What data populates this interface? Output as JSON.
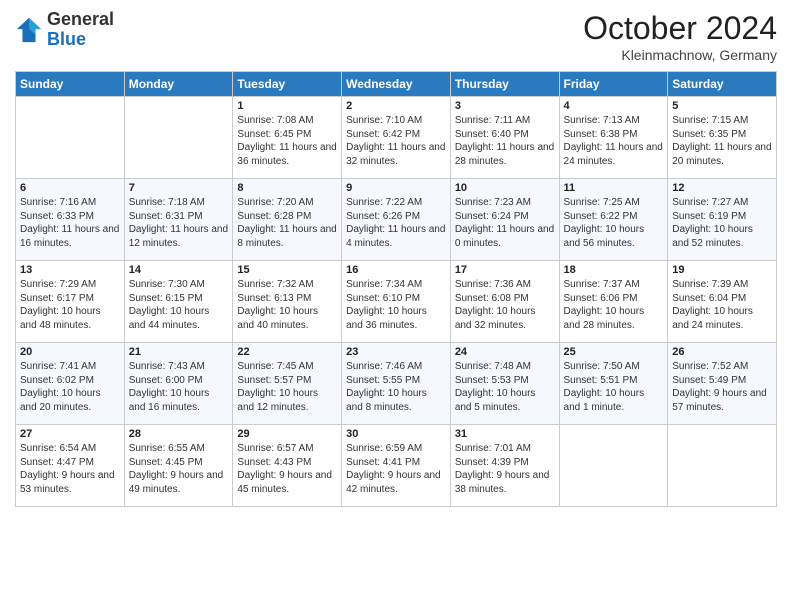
{
  "header": {
    "logo_general": "General",
    "logo_blue": "Blue",
    "month_year": "October 2024",
    "location": "Kleinmachnow, Germany"
  },
  "days_of_week": [
    "Sunday",
    "Monday",
    "Tuesday",
    "Wednesday",
    "Thursday",
    "Friday",
    "Saturday"
  ],
  "weeks": [
    [
      {
        "day": "",
        "text": ""
      },
      {
        "day": "",
        "text": ""
      },
      {
        "day": "1",
        "text": "Sunrise: 7:08 AM\nSunset: 6:45 PM\nDaylight: 11 hours and 36 minutes."
      },
      {
        "day": "2",
        "text": "Sunrise: 7:10 AM\nSunset: 6:42 PM\nDaylight: 11 hours and 32 minutes."
      },
      {
        "day": "3",
        "text": "Sunrise: 7:11 AM\nSunset: 6:40 PM\nDaylight: 11 hours and 28 minutes."
      },
      {
        "day": "4",
        "text": "Sunrise: 7:13 AM\nSunset: 6:38 PM\nDaylight: 11 hours and 24 minutes."
      },
      {
        "day": "5",
        "text": "Sunrise: 7:15 AM\nSunset: 6:35 PM\nDaylight: 11 hours and 20 minutes."
      }
    ],
    [
      {
        "day": "6",
        "text": "Sunrise: 7:16 AM\nSunset: 6:33 PM\nDaylight: 11 hours and 16 minutes."
      },
      {
        "day": "7",
        "text": "Sunrise: 7:18 AM\nSunset: 6:31 PM\nDaylight: 11 hours and 12 minutes."
      },
      {
        "day": "8",
        "text": "Sunrise: 7:20 AM\nSunset: 6:28 PM\nDaylight: 11 hours and 8 minutes."
      },
      {
        "day": "9",
        "text": "Sunrise: 7:22 AM\nSunset: 6:26 PM\nDaylight: 11 hours and 4 minutes."
      },
      {
        "day": "10",
        "text": "Sunrise: 7:23 AM\nSunset: 6:24 PM\nDaylight: 11 hours and 0 minutes."
      },
      {
        "day": "11",
        "text": "Sunrise: 7:25 AM\nSunset: 6:22 PM\nDaylight: 10 hours and 56 minutes."
      },
      {
        "day": "12",
        "text": "Sunrise: 7:27 AM\nSunset: 6:19 PM\nDaylight: 10 hours and 52 minutes."
      }
    ],
    [
      {
        "day": "13",
        "text": "Sunrise: 7:29 AM\nSunset: 6:17 PM\nDaylight: 10 hours and 48 minutes."
      },
      {
        "day": "14",
        "text": "Sunrise: 7:30 AM\nSunset: 6:15 PM\nDaylight: 10 hours and 44 minutes."
      },
      {
        "day": "15",
        "text": "Sunrise: 7:32 AM\nSunset: 6:13 PM\nDaylight: 10 hours and 40 minutes."
      },
      {
        "day": "16",
        "text": "Sunrise: 7:34 AM\nSunset: 6:10 PM\nDaylight: 10 hours and 36 minutes."
      },
      {
        "day": "17",
        "text": "Sunrise: 7:36 AM\nSunset: 6:08 PM\nDaylight: 10 hours and 32 minutes."
      },
      {
        "day": "18",
        "text": "Sunrise: 7:37 AM\nSunset: 6:06 PM\nDaylight: 10 hours and 28 minutes."
      },
      {
        "day": "19",
        "text": "Sunrise: 7:39 AM\nSunset: 6:04 PM\nDaylight: 10 hours and 24 minutes."
      }
    ],
    [
      {
        "day": "20",
        "text": "Sunrise: 7:41 AM\nSunset: 6:02 PM\nDaylight: 10 hours and 20 minutes."
      },
      {
        "day": "21",
        "text": "Sunrise: 7:43 AM\nSunset: 6:00 PM\nDaylight: 10 hours and 16 minutes."
      },
      {
        "day": "22",
        "text": "Sunrise: 7:45 AM\nSunset: 5:57 PM\nDaylight: 10 hours and 12 minutes."
      },
      {
        "day": "23",
        "text": "Sunrise: 7:46 AM\nSunset: 5:55 PM\nDaylight: 10 hours and 8 minutes."
      },
      {
        "day": "24",
        "text": "Sunrise: 7:48 AM\nSunset: 5:53 PM\nDaylight: 10 hours and 5 minutes."
      },
      {
        "day": "25",
        "text": "Sunrise: 7:50 AM\nSunset: 5:51 PM\nDaylight: 10 hours and 1 minute."
      },
      {
        "day": "26",
        "text": "Sunrise: 7:52 AM\nSunset: 5:49 PM\nDaylight: 9 hours and 57 minutes."
      }
    ],
    [
      {
        "day": "27",
        "text": "Sunrise: 6:54 AM\nSunset: 4:47 PM\nDaylight: 9 hours and 53 minutes."
      },
      {
        "day": "28",
        "text": "Sunrise: 6:55 AM\nSunset: 4:45 PM\nDaylight: 9 hours and 49 minutes."
      },
      {
        "day": "29",
        "text": "Sunrise: 6:57 AM\nSunset: 4:43 PM\nDaylight: 9 hours and 45 minutes."
      },
      {
        "day": "30",
        "text": "Sunrise: 6:59 AM\nSunset: 4:41 PM\nDaylight: 9 hours and 42 minutes."
      },
      {
        "day": "31",
        "text": "Sunrise: 7:01 AM\nSunset: 4:39 PM\nDaylight: 9 hours and 38 minutes."
      },
      {
        "day": "",
        "text": ""
      },
      {
        "day": "",
        "text": ""
      }
    ]
  ]
}
